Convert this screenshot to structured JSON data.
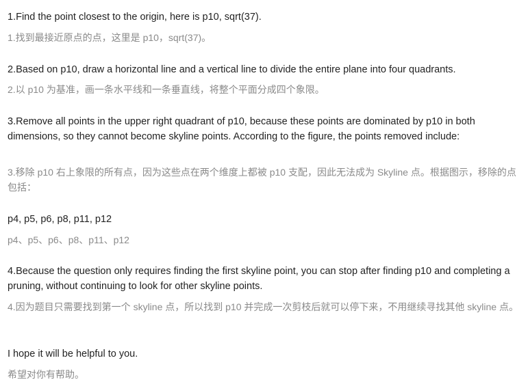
{
  "steps": [
    {
      "en": "1.Find the point closest to the origin, here is p10, sqrt(37).",
      "zh": "1.找到最接近原点的点，这里是 p10，sqrt(37)。"
    },
    {
      "en": "2.Based on p10, draw a horizontal line and a vertical line to divide the entire plane into four quadrants.",
      "zh": "2.以 p10 为基准，画一条水平线和一条垂直线，将整个平面分成四个象限。"
    },
    {
      "en": "3.Remove all points in the upper right quadrant of p10, because these points are dominated by p10 in both dimensions, so they cannot become skyline points. According to the figure, the points removed include:",
      "zh": "3.移除 p10 右上象限的所有点，因为这些点在两个维度上都被 p10 支配，因此无法成为 Skyline 点。根据图示，移除的点包括："
    },
    {
      "en": "p4, p5, p6, p8, p11, p12",
      "zh": "p4、p5、p6、p8、p11、p12"
    },
    {
      "en": "4.Because the question only requires finding the first skyline point, you can stop after finding p10 and completing a pruning, without continuing to look for other skyline points.",
      "zh": "4.因为题目只需要找到第一个 skyline 点，所以找到 p10 并完成一次剪枝后就可以停下来，不用继续寻找其他 skyline 点。"
    },
    {
      "en": "I hope it will be helpful to you.",
      "zh": "希望对你有帮助。"
    }
  ]
}
